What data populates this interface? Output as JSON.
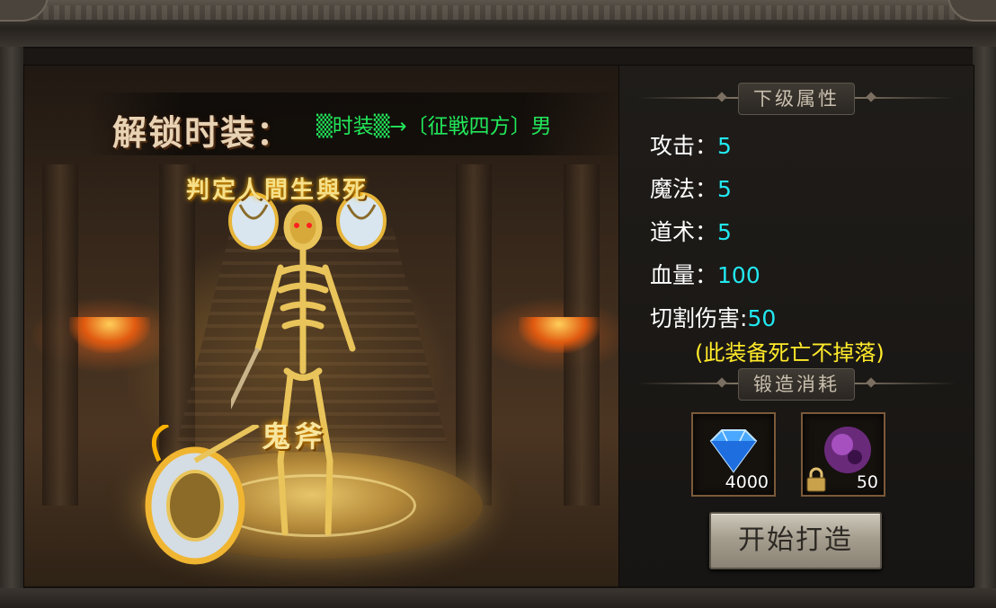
{
  "scene": {
    "unlock_title": "解锁时装：",
    "unlock_text": "▒时装▒→〔征戦四方〕男",
    "title_caption": "判定人間生與死",
    "weapon_caption": "鬼斧"
  },
  "attributes_panel": {
    "section_title": "下级属性",
    "stats": [
      {
        "label": "攻击：",
        "value": "5"
      },
      {
        "label": "魔法：",
        "value": "5"
      },
      {
        "label": "道术：",
        "value": "5"
      },
      {
        "label": "血量：",
        "value": "100"
      },
      {
        "label": "切割伤害:",
        "value": "50"
      }
    ],
    "note": "(此装备死亡不掉落)"
  },
  "forge_panel": {
    "section_title": "锻造消耗",
    "materials": [
      {
        "icon": "blue-diamond-icon",
        "count": "4000"
      },
      {
        "icon": "purple-orb-icon",
        "count": "50"
      }
    ],
    "button_label": "开始打造"
  },
  "colors": {
    "unlock_text": "#22e85a",
    "stat_value": "#22e8f0",
    "note": "#ffea2a"
  }
}
